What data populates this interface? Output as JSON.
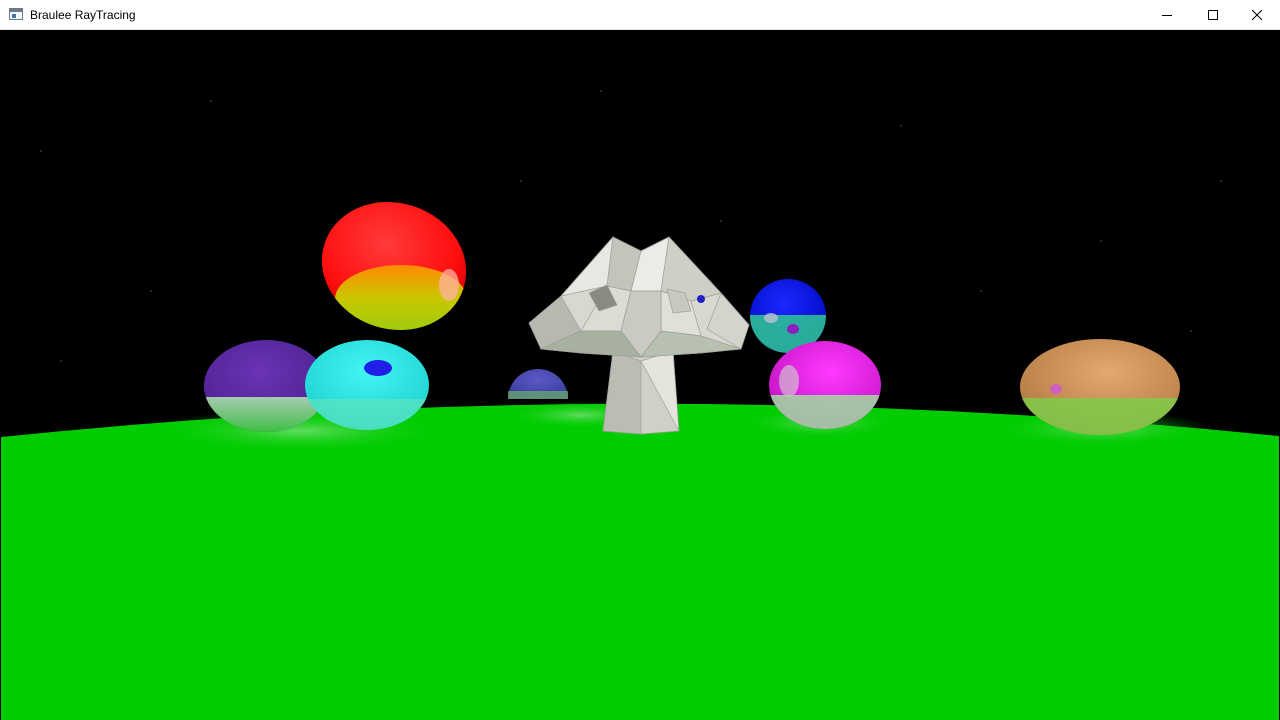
{
  "window": {
    "title": "Braulee RayTracing",
    "icon": "app-window-icon",
    "controls": {
      "minimize_icon": "minimize-icon",
      "maximize_icon": "maximize-icon",
      "close_icon": "close-icon"
    }
  },
  "scene": {
    "colors": {
      "background": "#000000",
      "ground": "#00cc00",
      "red_sphere": "#ff1a1a",
      "purple_sphere": "#5a2aa0",
      "cyan_sphere": "#22e6e6",
      "small_blue_sphere": "#4a4ab0",
      "blue_sphere": "#0a14e6",
      "magenta_sphere": "#e61ae6",
      "tan_sphere": "#d2965a",
      "mesh": "#d8d8d0"
    }
  }
}
